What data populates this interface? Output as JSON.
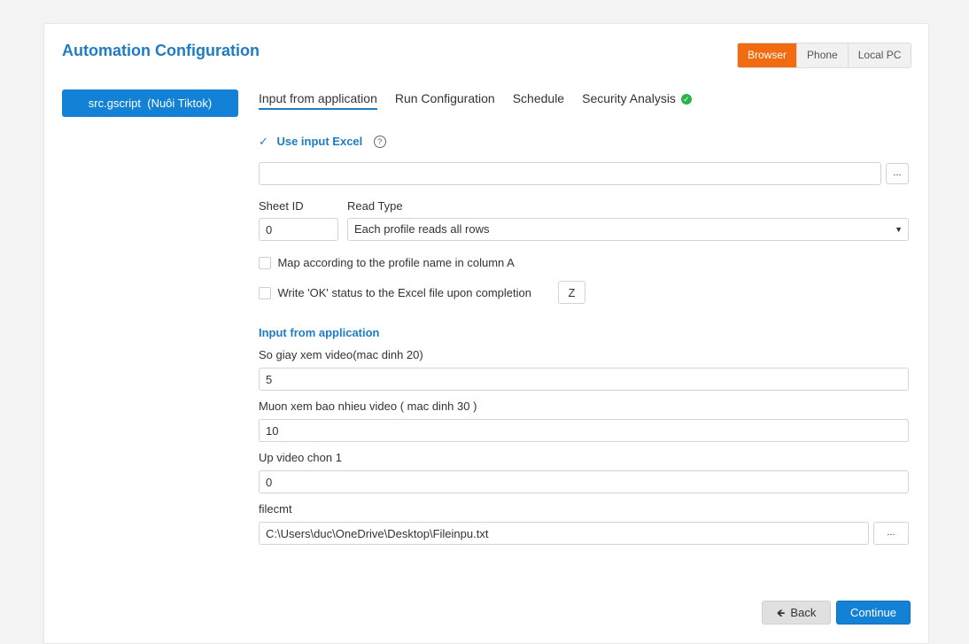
{
  "header": {
    "title": "Automation Configuration"
  },
  "target_tabs": [
    {
      "label": "Browser",
      "active": true
    },
    {
      "label": "Phone",
      "active": false
    },
    {
      "label": "Local PC",
      "active": false
    }
  ],
  "sidebar": {
    "script_button": "src.gscript  (Nuôi Tiktok)"
  },
  "tabs": [
    {
      "label": "Input from application",
      "active": true
    },
    {
      "label": "Run Configuration",
      "active": false
    },
    {
      "label": "Schedule",
      "active": false
    },
    {
      "label": "Security Analysis",
      "active": false
    }
  ],
  "excel": {
    "use_label": "Use input Excel",
    "use_checked": true,
    "path_value": "",
    "browse_label": "...",
    "sheet_id_label": "Sheet ID",
    "sheet_id_value": "0",
    "read_type_label": "Read Type",
    "read_type_value": "Each profile reads all rows",
    "map_label": "Map according to the profile name in column A",
    "write_ok_label": "Write 'OK' status to the Excel file upon completion",
    "column_value": "Z"
  },
  "app_input": {
    "heading": "Input from application",
    "fields": [
      {
        "label": "So giay xem video(mac dinh 20)",
        "value": "5"
      },
      {
        "label": "Muon xem bao nhieu video ( mac dinh 30 )",
        "value": "10"
      },
      {
        "label": "Up video chon 1",
        "value": "0"
      },
      {
        "label": "filecmt",
        "value": "C:\\Users\\duc\\OneDrive\\Desktop\\Fileinpu.txt"
      }
    ],
    "browse_label": "..."
  },
  "footer": {
    "back_label": "Back",
    "continue_label": "Continue"
  },
  "colors": {
    "accent": "#1e7cc4",
    "primary_button": "#1381d6",
    "active_segment": "#f26b0f",
    "ok": "#2bb24c"
  }
}
